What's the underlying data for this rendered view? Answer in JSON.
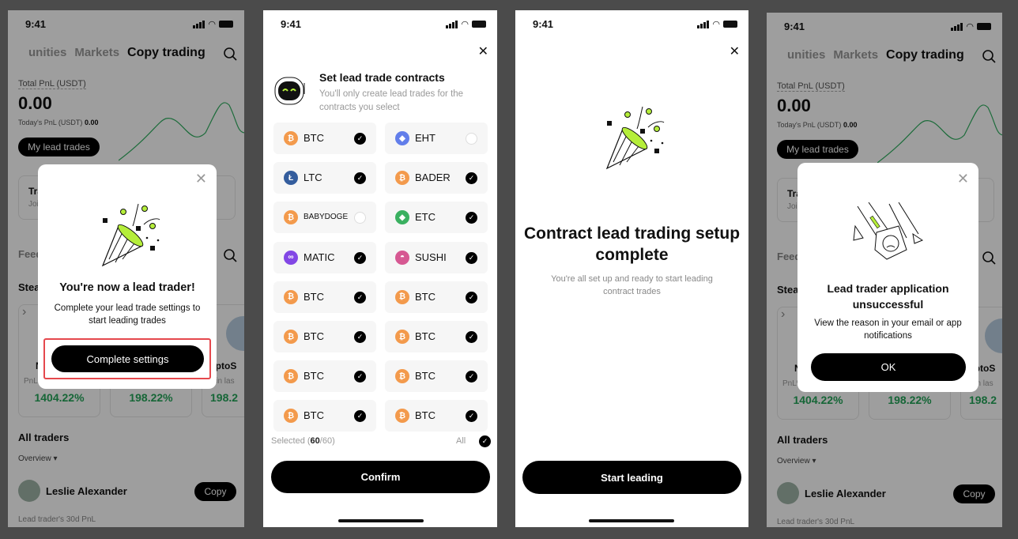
{
  "status": {
    "time": "9:41"
  },
  "bg_app": {
    "tabs": [
      "unities",
      "Markets",
      "Copy trading"
    ],
    "total_pnl_label": "Total PnL (USDT)",
    "total_pnl": "0.00",
    "today_pnl_label": "Today's PnL (USDT)",
    "today_pnl": "0.00",
    "my_lead_trades": "My lead trades",
    "banner_title": "Tra",
    "banner_sub": "Joi",
    "feed": "Feed",
    "steady": "Stea",
    "traders": [
      {
        "name": "N",
        "pnl_label": "PnL%",
        "pnl": "1404.22%"
      },
      {
        "name": "",
        "pnl_label": "",
        "pnl": "198.22%"
      },
      {
        "name": "KriptoS",
        "pnl_label": "L% in las",
        "pnl": "198.2"
      }
    ],
    "all_traders": "All traders",
    "overview": "Overview",
    "trader_name": "Leslie Alexander",
    "copy": "Copy",
    "pnl_30d": "Lead trader's 30d PnL"
  },
  "modal_success": {
    "title": "You're now a lead trader!",
    "desc": "Complete your lead trade settings to start leading trades",
    "button": "Complete settings",
    "highlight_color": "#e5484d"
  },
  "contracts": {
    "title": "Set lead trade contracts",
    "subtitle": "You'll only create lead trades for the contracts you select",
    "items": [
      {
        "name": "BTC",
        "icon": "bitcoin-icon",
        "color": "#f39a4c",
        "checked": true
      },
      {
        "name": "EHT",
        "icon": "ethereum-icon",
        "color": "#627eea",
        "checked": false
      },
      {
        "name": "LTC",
        "icon": "litecoin-icon",
        "color": "#345d9d",
        "checked": true
      },
      {
        "name": "BADER",
        "icon": "bitcoin-icon",
        "color": "#f39a4c",
        "checked": true
      },
      {
        "name": "BABYDOGE",
        "icon": "bitcoin-icon",
        "color": "#f39a4c",
        "checked": false
      },
      {
        "name": "ETC",
        "icon": "ethereum-classic-icon",
        "color": "#3ab060",
        "checked": true
      },
      {
        "name": "MATIC",
        "icon": "polygon-icon",
        "color": "#8247e5",
        "checked": true
      },
      {
        "name": "SUSHI",
        "icon": "sushi-icon",
        "color": "#d65892",
        "checked": true
      },
      {
        "name": "BTC",
        "icon": "bitcoin-icon",
        "color": "#f39a4c",
        "checked": true
      },
      {
        "name": "BTC",
        "icon": "bitcoin-icon",
        "color": "#f39a4c",
        "checked": true
      },
      {
        "name": "BTC",
        "icon": "bitcoin-icon",
        "color": "#f39a4c",
        "checked": true
      },
      {
        "name": "BTC",
        "icon": "bitcoin-icon",
        "color": "#f39a4c",
        "checked": true
      },
      {
        "name": "BTC",
        "icon": "bitcoin-icon",
        "color": "#f39a4c",
        "checked": true
      },
      {
        "name": "BTC",
        "icon": "bitcoin-icon",
        "color": "#f39a4c",
        "checked": true
      },
      {
        "name": "BTC",
        "icon": "bitcoin-icon",
        "color": "#f39a4c",
        "checked": true
      },
      {
        "name": "BTC",
        "icon": "bitcoin-icon",
        "color": "#f39a4c",
        "checked": true
      }
    ],
    "selected_label": "Selected (",
    "selected": "60",
    "total": "/60)",
    "all": "All",
    "confirm": "Confirm"
  },
  "complete": {
    "title": "Contract lead trading setup complete",
    "desc": "You're all set up and ready to start leading contract trades",
    "button": "Start leading"
  },
  "modal_fail": {
    "title": "Lead trader application unsuccessful",
    "desc": "View the reason in your email or app notifications",
    "button": "OK"
  },
  "colors": {
    "accent_green": "#b5ee3a",
    "pnl_green": "#25a55a"
  }
}
